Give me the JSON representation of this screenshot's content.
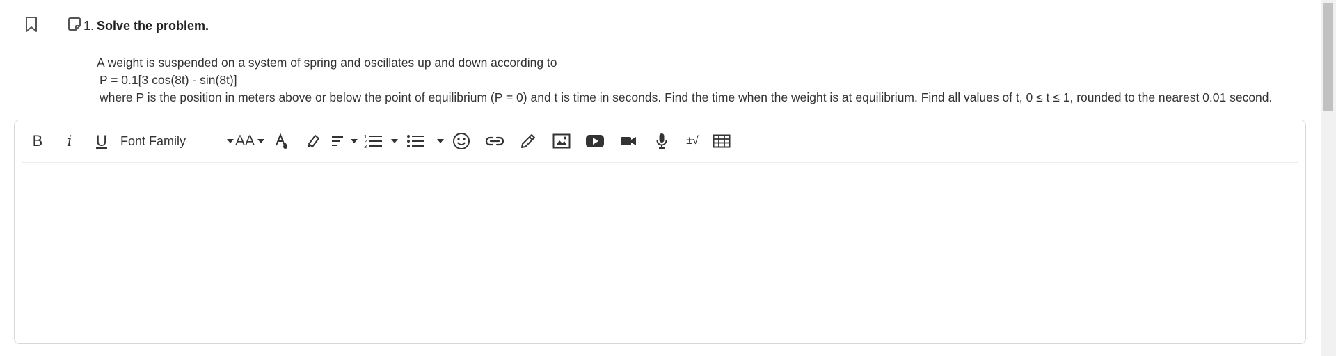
{
  "question": {
    "number": "1.",
    "title": "Solve the problem.",
    "lines": [
      "A weight is suspended on a system of spring and oscillates up and down according to",
      "P = 0.1[3 cos(8t) - sin(8t)]",
      "where P is the position in meters above or below the point of equilibrium (P = 0) and t is time in seconds. Find the time when the weight is at equilibrium. Find all values of t, 0 ≤ t ≤ 1, rounded to the nearest 0.01 second."
    ]
  },
  "toolbar": {
    "bold": "B",
    "italic": "i",
    "underline": "U",
    "font_family": "Font Family",
    "font_size": "AA",
    "equation": "±√"
  }
}
